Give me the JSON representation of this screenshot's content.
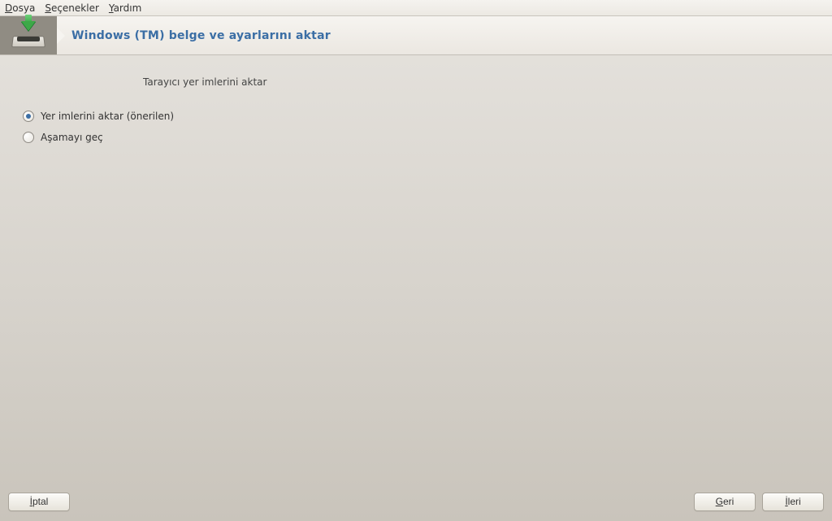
{
  "menubar": {
    "items": [
      {
        "prefix": "D",
        "rest": "osya"
      },
      {
        "prefix": "S",
        "rest": "eçenekler"
      },
      {
        "prefix": "Y",
        "rest": "ardım"
      }
    ]
  },
  "header": {
    "title": "Windows (TM) belge ve ayarlarını aktar",
    "icon": "import-tray-icon",
    "accent_color": "#3b6ea5"
  },
  "content": {
    "section_title": "Tarayıcı yer imlerini aktar",
    "options": [
      {
        "id": "import-bookmarks",
        "label": "Yer imlerini aktar (önerilen)",
        "checked": true
      },
      {
        "id": "skip-step",
        "label": "Aşamayı geç",
        "checked": false
      }
    ]
  },
  "footer": {
    "cancel": {
      "prefix": "İ",
      "rest": "ptal"
    },
    "back": {
      "prefix": "G",
      "rest": "eri"
    },
    "next": {
      "prefix": "İ",
      "rest": "leri"
    }
  }
}
